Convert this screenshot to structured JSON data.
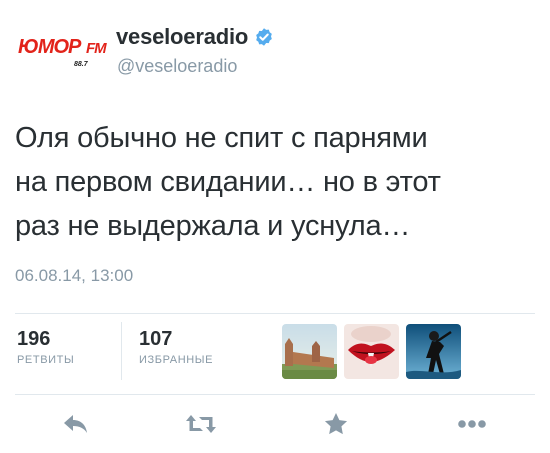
{
  "account": {
    "display_name": "veseloeradio",
    "handle": "@veseloeradio",
    "verified": true,
    "avatar_logo_text": "ЮМОР FM",
    "avatar_logo_main": "ЮМОР",
    "avatar_logo_fm": "FM",
    "avatar_frequency": "88.7",
    "verified_color": "#55acee",
    "logo_color": "#e2231a"
  },
  "tweet": {
    "lines": [
      "Оля обычно не спит с парнями",
      "на первом свидании… но в этот",
      "раз не выдержала и уснула…"
    ],
    "timestamp": "06.08.14, 13:00"
  },
  "stats": {
    "retweets": {
      "count": "196",
      "label": "РЕТВИТЫ"
    },
    "favorites": {
      "count": "107",
      "label": "ИЗБРАННЫЕ"
    }
  },
  "favoriters": [
    {
      "icon": "fortress-wall-photo-avatar"
    },
    {
      "icon": "red-lips-avatar"
    },
    {
      "icon": "silhouette-blue-avatar"
    }
  ],
  "actions": [
    {
      "name": "reply",
      "icon": "reply-icon"
    },
    {
      "name": "retweet",
      "icon": "retweet-icon"
    },
    {
      "name": "favorite",
      "icon": "star-icon"
    },
    {
      "name": "more",
      "icon": "more-dots-icon"
    }
  ],
  "colors": {
    "text": "#292f33",
    "muted": "#8899a6",
    "divider": "#e1e8ed",
    "action_icon": "#8899a6"
  }
}
